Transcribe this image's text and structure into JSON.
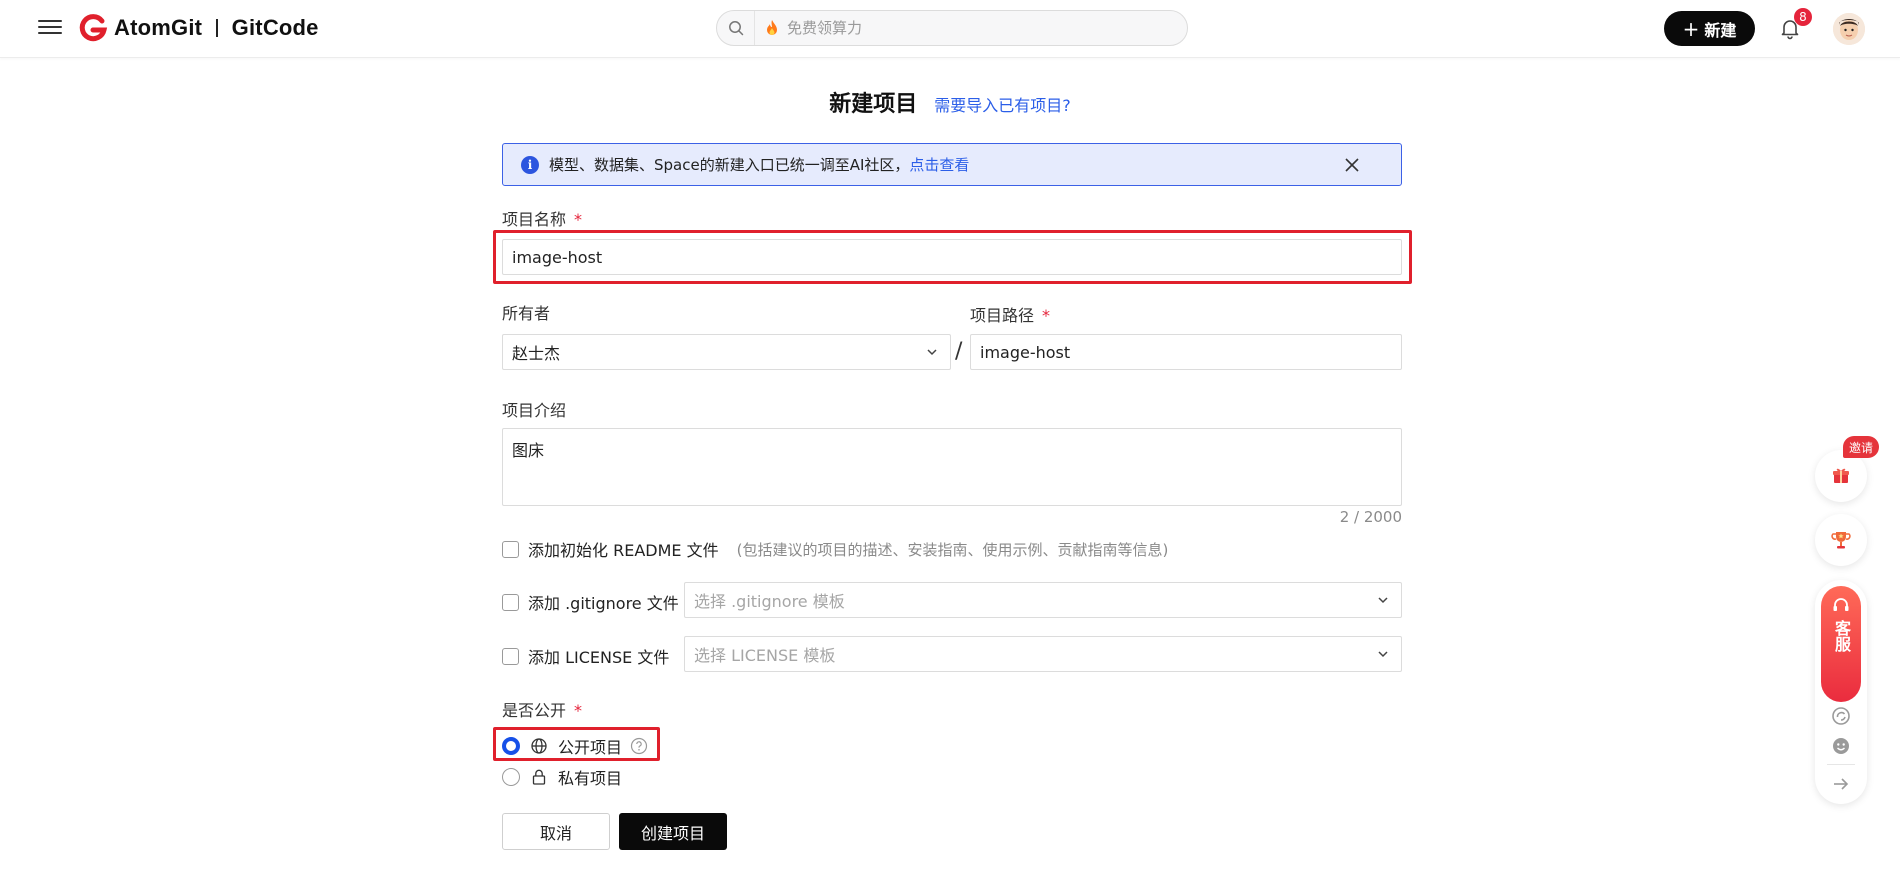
{
  "header": {
    "brand_left": "AtomGit",
    "brand_right": "GitCode",
    "search_placeholder": "免费领算力",
    "new_button": "新建",
    "new_plus": "+",
    "notification_count": "8"
  },
  "page": {
    "title": "新建项目",
    "import_link": "需要导入已有项目?"
  },
  "notice": {
    "info_icon": "i",
    "text": "模型、数据集、Space的新建入口已统一调至AI社区，",
    "link": "点击查看"
  },
  "form": {
    "name_label": "项目名称",
    "name_value": "image-host",
    "owner_label": "所有者",
    "owner_value": "赵士杰",
    "path_label": "项目路径",
    "path_value": "image-host",
    "path_slash": "/",
    "required_mark": "*",
    "description_label": "项目介绍",
    "description_value": "图床",
    "description_counter": "2 / 2000",
    "readme_label": "添加初始化 README 文件",
    "readme_hint": "(包括建议的项目的描述、安装指南、使用示例、贡献指南等信息)",
    "gitignore_label": "添加 .gitignore 文件",
    "gitignore_placeholder": "选择 .gitignore 模板",
    "license_label": "添加 LICENSE 文件",
    "license_placeholder": "选择 LICENSE 模板",
    "visibility_label": "是否公开",
    "public_label": "公开项目",
    "private_label": "私有项目",
    "selected_visibility": "public",
    "cancel_button": "取消",
    "create_button": "创建项目"
  },
  "side_float": {
    "invite_badge": "邀请",
    "customer_service": "客服"
  },
  "colors": {
    "accent": "#2b5ee8",
    "required": "#e5243b",
    "highlight": "#e0202c",
    "primary_button": "#0a0a0a"
  }
}
